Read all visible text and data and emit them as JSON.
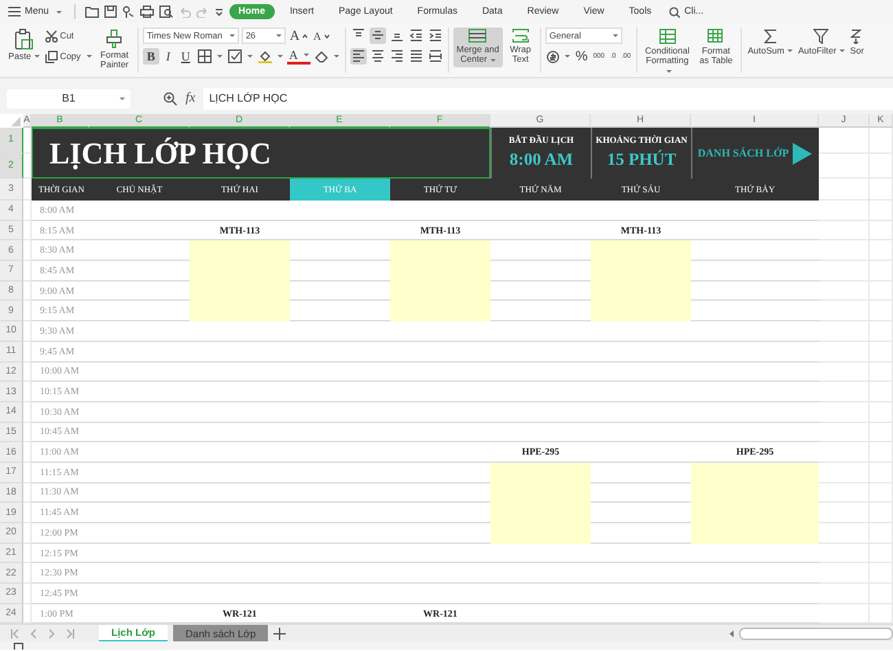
{
  "menubar": {
    "menu": "Menu",
    "tabs": [
      {
        "label": "Home",
        "selected": true
      },
      {
        "label": "Insert",
        "selected": false
      },
      {
        "label": "Page Layout",
        "selected": false
      },
      {
        "label": "Formulas",
        "selected": false
      },
      {
        "label": "Data",
        "selected": false
      },
      {
        "label": "Review",
        "selected": false
      },
      {
        "label": "View",
        "selected": false
      },
      {
        "label": "Tools",
        "selected": false
      }
    ],
    "search": "Cli..."
  },
  "ribbon": {
    "paste": "Paste",
    "cut": "Cut",
    "copy": "Copy",
    "format_painter": "Format Painter",
    "font_name": "Times New Roman",
    "font_size": "26",
    "size_buttons": [
      {
        "kind": "grow",
        "label": "A"
      },
      {
        "kind": "shrink",
        "label": "A"
      }
    ],
    "format_buttons": [
      {
        "kind": "bold",
        "label": "B",
        "on": true
      },
      {
        "kind": "italic",
        "label": "I",
        "on": false
      },
      {
        "kind": "underline",
        "label": "U",
        "on": false
      },
      {
        "kind": "borders",
        "on": false
      },
      {
        "kind": "cell-style",
        "on": false
      },
      {
        "kind": "fill-color",
        "on": false
      },
      {
        "kind": "font-color",
        "label": "A",
        "on": false
      },
      {
        "kind": "eraser",
        "on": false
      }
    ],
    "align_top": [
      {
        "kind": "top",
        "on": false
      },
      {
        "kind": "middle",
        "on": true
      },
      {
        "kind": "bottom",
        "on": false
      },
      {
        "kind": "indent-less",
        "on": false
      },
      {
        "kind": "indent-more",
        "on": false
      }
    ],
    "align_bottom": [
      {
        "kind": "left",
        "on": true
      },
      {
        "kind": "center",
        "on": false
      },
      {
        "kind": "right",
        "on": false
      },
      {
        "kind": "justify",
        "on": false
      },
      {
        "kind": "distributed",
        "on": false
      }
    ],
    "merge": {
      "label": "Merge and Center",
      "on": true
    },
    "wrap": "Wrap Text",
    "number_format": "General",
    "number_buttons": [
      {
        "kind": "currency"
      },
      {
        "kind": "percent",
        "label": "%"
      },
      {
        "kind": "thousands",
        "label": "000"
      },
      {
        "kind": "inc-decimal",
        "label": ".0"
      },
      {
        "kind": "dec-decimal",
        "label": ".00"
      }
    ],
    "conditional": "Conditional Formatting",
    "format_table": "Format as Table",
    "autosum": "AutoSum",
    "autofilter": "AutoFilter",
    "sort": "Sor"
  },
  "formula_bar": {
    "cell": "B1",
    "fx": "fx",
    "value": "LỊCH LỚP HỌC"
  },
  "sheet": {
    "letters": [
      {
        "label": "A",
        "selected": false
      },
      {
        "label": "B",
        "selected": true
      },
      {
        "label": "C",
        "selected": true
      },
      {
        "label": "D",
        "selected": true
      },
      {
        "label": "E",
        "selected": true
      },
      {
        "label": "F",
        "selected": true
      },
      {
        "label": "G",
        "selected": false
      },
      {
        "label": "H",
        "selected": false
      },
      {
        "label": "I",
        "selected": false
      },
      {
        "label": "J",
        "selected": false
      },
      {
        "label": "K",
        "selected": false
      }
    ],
    "header_rows": [
      {
        "label": "1",
        "selected": true
      },
      {
        "label": "2",
        "selected": true
      },
      {
        "label": "3",
        "selected": false
      }
    ],
    "title": "LỊCH LỚP HỌC",
    "start": {
      "label": "BẮT ĐẦU LỊCH",
      "value": "8:00 AM"
    },
    "interval": {
      "label": "KHOẢNG THỜI GIAN",
      "value": "15 PHÚT"
    },
    "link": "DANH SÁCH LỚP",
    "time_header": "THỜI GIAN",
    "days": [
      {
        "label": "CHỦ NHẬT",
        "selected": false
      },
      {
        "label": "THỨ HAI",
        "selected": false
      },
      {
        "label": "THỨ BA",
        "selected": true
      },
      {
        "label": "THỨ TƯ",
        "selected": false
      },
      {
        "label": "THỨ NĂM",
        "selected": false
      },
      {
        "label": "THỨ SÁU",
        "selected": false
      },
      {
        "label": "THỨ BẢY",
        "selected": false
      }
    ],
    "rows": [
      {
        "number": "4",
        "time": "8:00 AM",
        "cells": [
          {
            "kind": "empty"
          },
          {
            "kind": "empty"
          },
          {
            "kind": "empty"
          },
          {
            "kind": "empty"
          },
          {
            "kind": "empty"
          },
          {
            "kind": "empty"
          },
          {
            "kind": "empty"
          }
        ]
      },
      {
        "number": "5",
        "time": "8:15 AM",
        "cells": [
          {
            "kind": "empty"
          },
          {
            "kind": "label",
            "text": "MTH-113"
          },
          {
            "kind": "empty"
          },
          {
            "kind": "label",
            "text": "MTH-113"
          },
          {
            "kind": "empty"
          },
          {
            "kind": "label",
            "text": "MTH-113"
          },
          {
            "kind": "empty"
          }
        ]
      },
      {
        "number": "6",
        "time": "8:30 AM",
        "cells": [
          {
            "kind": "empty"
          },
          {
            "kind": "block"
          },
          {
            "kind": "empty"
          },
          {
            "kind": "block"
          },
          {
            "kind": "empty"
          },
          {
            "kind": "block"
          },
          {
            "kind": "empty"
          }
        ]
      },
      {
        "number": "7",
        "time": "8:45 AM",
        "cells": [
          {
            "kind": "empty"
          },
          {
            "kind": "block"
          },
          {
            "kind": "empty"
          },
          {
            "kind": "block"
          },
          {
            "kind": "empty"
          },
          {
            "kind": "block"
          },
          {
            "kind": "empty"
          }
        ]
      },
      {
        "number": "8",
        "time": "9:00 AM",
        "cells": [
          {
            "kind": "empty"
          },
          {
            "kind": "block"
          },
          {
            "kind": "empty"
          },
          {
            "kind": "block"
          },
          {
            "kind": "empty"
          },
          {
            "kind": "block"
          },
          {
            "kind": "empty"
          }
        ]
      },
      {
        "number": "9",
        "time": "9:15 AM",
        "cells": [
          {
            "kind": "empty"
          },
          {
            "kind": "block"
          },
          {
            "kind": "empty"
          },
          {
            "kind": "block"
          },
          {
            "kind": "empty"
          },
          {
            "kind": "block"
          },
          {
            "kind": "empty"
          }
        ]
      },
      {
        "number": "10",
        "time": "9:30 AM",
        "cells": [
          {
            "kind": "empty"
          },
          {
            "kind": "empty"
          },
          {
            "kind": "empty"
          },
          {
            "kind": "empty"
          },
          {
            "kind": "empty"
          },
          {
            "kind": "empty"
          },
          {
            "kind": "empty"
          }
        ]
      },
      {
        "number": "11",
        "time": "9:45 AM",
        "cells": [
          {
            "kind": "empty"
          },
          {
            "kind": "empty"
          },
          {
            "kind": "empty"
          },
          {
            "kind": "empty"
          },
          {
            "kind": "empty"
          },
          {
            "kind": "empty"
          },
          {
            "kind": "empty"
          }
        ]
      },
      {
        "number": "12",
        "time": "10:00 AM",
        "cells": [
          {
            "kind": "empty"
          },
          {
            "kind": "empty"
          },
          {
            "kind": "empty"
          },
          {
            "kind": "empty"
          },
          {
            "kind": "empty"
          },
          {
            "kind": "empty"
          },
          {
            "kind": "empty"
          }
        ]
      },
      {
        "number": "13",
        "time": "10:15 AM",
        "cells": [
          {
            "kind": "empty"
          },
          {
            "kind": "empty"
          },
          {
            "kind": "empty"
          },
          {
            "kind": "empty"
          },
          {
            "kind": "empty"
          },
          {
            "kind": "empty"
          },
          {
            "kind": "empty"
          }
        ]
      },
      {
        "number": "14",
        "time": "10:30 AM",
        "cells": [
          {
            "kind": "empty"
          },
          {
            "kind": "empty"
          },
          {
            "kind": "empty"
          },
          {
            "kind": "empty"
          },
          {
            "kind": "empty"
          },
          {
            "kind": "empty"
          },
          {
            "kind": "empty"
          }
        ]
      },
      {
        "number": "15",
        "time": "10:45 AM",
        "cells": [
          {
            "kind": "empty"
          },
          {
            "kind": "empty"
          },
          {
            "kind": "empty"
          },
          {
            "kind": "empty"
          },
          {
            "kind": "empty"
          },
          {
            "kind": "empty"
          },
          {
            "kind": "empty"
          }
        ]
      },
      {
        "number": "16",
        "time": "11:00 AM",
        "cells": [
          {
            "kind": "empty"
          },
          {
            "kind": "empty"
          },
          {
            "kind": "empty"
          },
          {
            "kind": "empty"
          },
          {
            "kind": "label",
            "text": "HPE-295"
          },
          {
            "kind": "empty"
          },
          {
            "kind": "label",
            "text": "HPE-295"
          }
        ]
      },
      {
        "number": "17",
        "time": "11:15 AM",
        "cells": [
          {
            "kind": "empty"
          },
          {
            "kind": "empty"
          },
          {
            "kind": "empty"
          },
          {
            "kind": "empty"
          },
          {
            "kind": "block"
          },
          {
            "kind": "empty"
          },
          {
            "kind": "block"
          }
        ]
      },
      {
        "number": "18",
        "time": "11:30 AM",
        "cells": [
          {
            "kind": "empty"
          },
          {
            "kind": "empty"
          },
          {
            "kind": "empty"
          },
          {
            "kind": "empty"
          },
          {
            "kind": "block"
          },
          {
            "kind": "empty"
          },
          {
            "kind": "block"
          }
        ]
      },
      {
        "number": "19",
        "time": "11:45 AM",
        "cells": [
          {
            "kind": "empty"
          },
          {
            "kind": "empty"
          },
          {
            "kind": "empty"
          },
          {
            "kind": "empty"
          },
          {
            "kind": "block"
          },
          {
            "kind": "empty"
          },
          {
            "kind": "block"
          }
        ]
      },
      {
        "number": "20",
        "time": "12:00 PM",
        "cells": [
          {
            "kind": "empty"
          },
          {
            "kind": "empty"
          },
          {
            "kind": "empty"
          },
          {
            "kind": "empty"
          },
          {
            "kind": "block"
          },
          {
            "kind": "empty"
          },
          {
            "kind": "block"
          }
        ]
      },
      {
        "number": "21",
        "time": "12:15 PM",
        "cells": [
          {
            "kind": "empty"
          },
          {
            "kind": "empty"
          },
          {
            "kind": "empty"
          },
          {
            "kind": "empty"
          },
          {
            "kind": "empty"
          },
          {
            "kind": "empty"
          },
          {
            "kind": "empty"
          }
        ]
      },
      {
        "number": "22",
        "time": "12:30 PM",
        "cells": [
          {
            "kind": "empty"
          },
          {
            "kind": "empty"
          },
          {
            "kind": "empty"
          },
          {
            "kind": "empty"
          },
          {
            "kind": "empty"
          },
          {
            "kind": "empty"
          },
          {
            "kind": "empty"
          }
        ]
      },
      {
        "number": "23",
        "time": "12:45 PM",
        "cells": [
          {
            "kind": "empty"
          },
          {
            "kind": "empty"
          },
          {
            "kind": "empty"
          },
          {
            "kind": "empty"
          },
          {
            "kind": "empty"
          },
          {
            "kind": "empty"
          },
          {
            "kind": "empty"
          }
        ]
      },
      {
        "number": "24",
        "time": "1:00 PM",
        "cells": [
          {
            "kind": "empty"
          },
          {
            "kind": "label",
            "text": "WR-121"
          },
          {
            "kind": "empty"
          },
          {
            "kind": "label",
            "text": "WR-121"
          },
          {
            "kind": "empty"
          },
          {
            "kind": "empty"
          },
          {
            "kind": "empty"
          }
        ]
      }
    ]
  },
  "sheet_tabs": [
    {
      "label": "Lịch Lớp",
      "selected": true
    },
    {
      "label": "Danh sách Lớp",
      "selected": false
    }
  ]
}
